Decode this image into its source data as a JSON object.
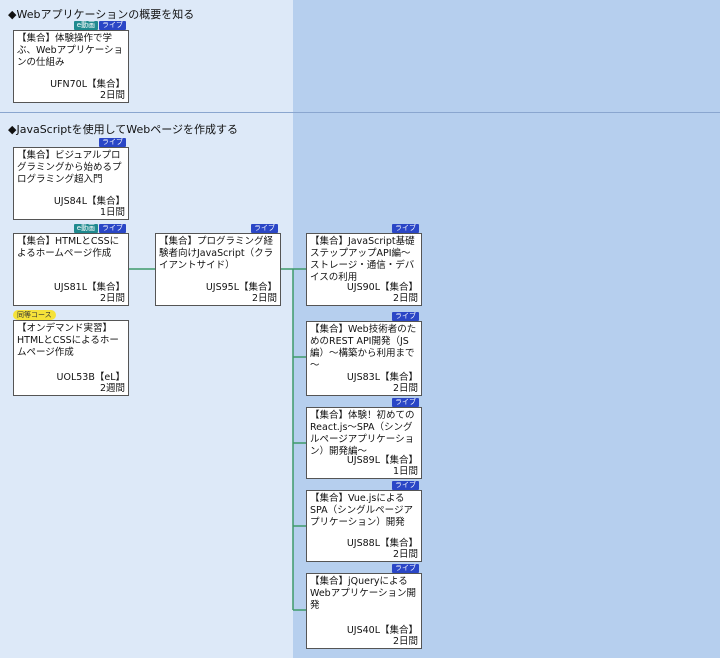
{
  "sections": [
    {
      "title": "◆Webアプリケーションの概要を知る"
    },
    {
      "title": "◆JavaScriptを使用してWebページを作成する"
    }
  ],
  "badges": {
    "live": "ライブ",
    "e_video": "e動画"
  },
  "same_course_label": "同等コース",
  "cards": [
    {
      "name": "【集合】体験操作で学ぶ、Webアプリケーションの仕組み",
      "code": "UFN70L【集合】",
      "duration": "2日間"
    },
    {
      "name": "【集合】ビジュアルプログラミングから始めるプログラミング超入門",
      "code": "UJS84L【集合】",
      "duration": "1日間"
    },
    {
      "name": "【集合】HTMLとCSSによるホームページ作成",
      "code": "UJS81L【集合】",
      "duration": "2日間"
    },
    {
      "name": "【オンデマンド実習】HTMLとCSSによるホームページ作成",
      "code": "UOL53B【eL】",
      "duration": "2週間"
    },
    {
      "name": "【集合】プログラミング経験者向けJavaScript（クライアントサイド）",
      "code": "UJS95L【集合】",
      "duration": "2日間"
    },
    {
      "name": "【集合】JavaScript基礎ステップアップAPI編～ストレージ・通信・デバイスの利用",
      "code": "UJS90L【集合】",
      "duration": "2日間"
    },
    {
      "name": "【集合】Web技術者のためのREST API開発（JS編）～構築から利用まで～",
      "code": "UJS83L【集合】",
      "duration": "2日間"
    },
    {
      "name": "【集合】体験！初めてのReact.js～SPA（シングルページアプリケーション）開発編～",
      "code": "UJS89L【集合】",
      "duration": "1日間"
    },
    {
      "name": "【集合】Vue.jsによるSPA（シングルページアプリケーション）開発",
      "code": "UJS88L【集合】",
      "duration": "2日間"
    },
    {
      "name": "【集合】jQueryによるWebアプリケーション開発",
      "code": "UJS40L【集合】",
      "duration": "2日間"
    }
  ],
  "colors": {
    "live_badge": "#2a46c6",
    "e_video_badge": "#1f8a8f",
    "connector": "#3f9a6a",
    "same_course": "#f5e23a"
  }
}
